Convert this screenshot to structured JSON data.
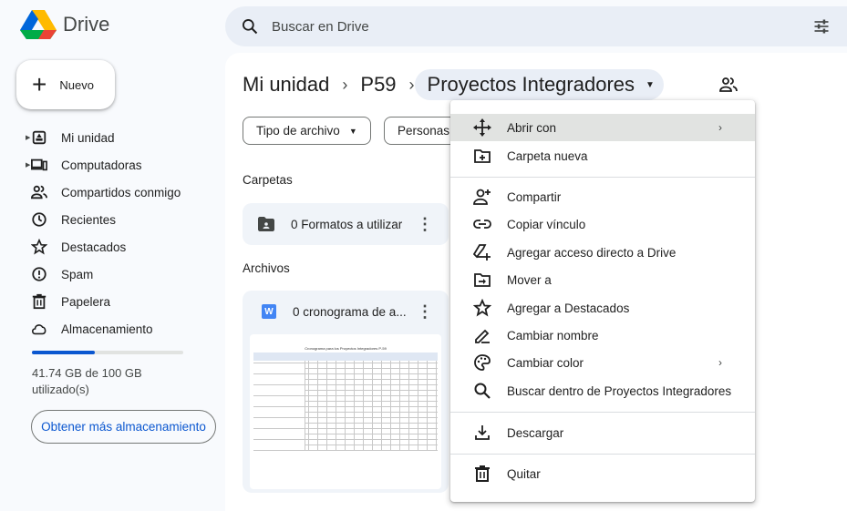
{
  "app": {
    "name": "Drive"
  },
  "search": {
    "placeholder": "Buscar en Drive"
  },
  "new_button": {
    "label": "Nuevo"
  },
  "nav": {
    "items": [
      {
        "label": "Mi unidad",
        "icon": "my-drive-icon"
      },
      {
        "label": "Computadoras",
        "icon": "computer-icon"
      },
      {
        "label": "Compartidos conmigo",
        "icon": "shared-icon"
      },
      {
        "label": "Recientes",
        "icon": "clock-icon"
      },
      {
        "label": "Destacados",
        "icon": "star-icon"
      },
      {
        "label": "Spam",
        "icon": "spam-icon"
      },
      {
        "label": "Papelera",
        "icon": "trash-icon"
      },
      {
        "label": "Almacenamiento",
        "icon": "cloud-icon"
      }
    ]
  },
  "storage": {
    "used_text": "41.74 GB de 100 GB utilizado(s)",
    "used_fraction": 0.4174,
    "button": "Obtener más almacenamiento"
  },
  "breadcrumb": {
    "root": "Mi unidad",
    "middle": "P59",
    "current": "Proyectos Integradores"
  },
  "filters": {
    "type": "Tipo de archivo",
    "people": "Personas"
  },
  "sections": {
    "folders": "Carpetas",
    "files": "Archivos"
  },
  "folder": {
    "name": "0 Formatos a utilizar"
  },
  "file": {
    "name": "0 cronograma de a...",
    "type_badge": "W"
  },
  "thumbnail": {
    "title": "Cronograma para los Proyectos Integradores P-59"
  },
  "context_menu": {
    "items": [
      {
        "label": "Abrir con",
        "icon": "open-with-icon",
        "submenu": true
      },
      {
        "label": "Carpeta nueva",
        "icon": "new-folder-icon"
      },
      {
        "label": "Compartir",
        "icon": "share-icon"
      },
      {
        "label": "Copiar vínculo",
        "icon": "link-icon"
      },
      {
        "label": "Agregar acceso directo a Drive",
        "icon": "add-shortcut-icon"
      },
      {
        "label": "Mover a",
        "icon": "move-icon"
      },
      {
        "label": "Agregar a Destacados",
        "icon": "star-icon"
      },
      {
        "label": "Cambiar nombre",
        "icon": "rename-icon"
      },
      {
        "label": "Cambiar color",
        "icon": "palette-icon",
        "submenu": true
      },
      {
        "label": "Buscar dentro de Proyectos Integradores",
        "icon": "search-icon"
      },
      {
        "label": "Descargar",
        "icon": "download-icon"
      },
      {
        "label": "Quitar",
        "icon": "trash-icon"
      }
    ]
  }
}
